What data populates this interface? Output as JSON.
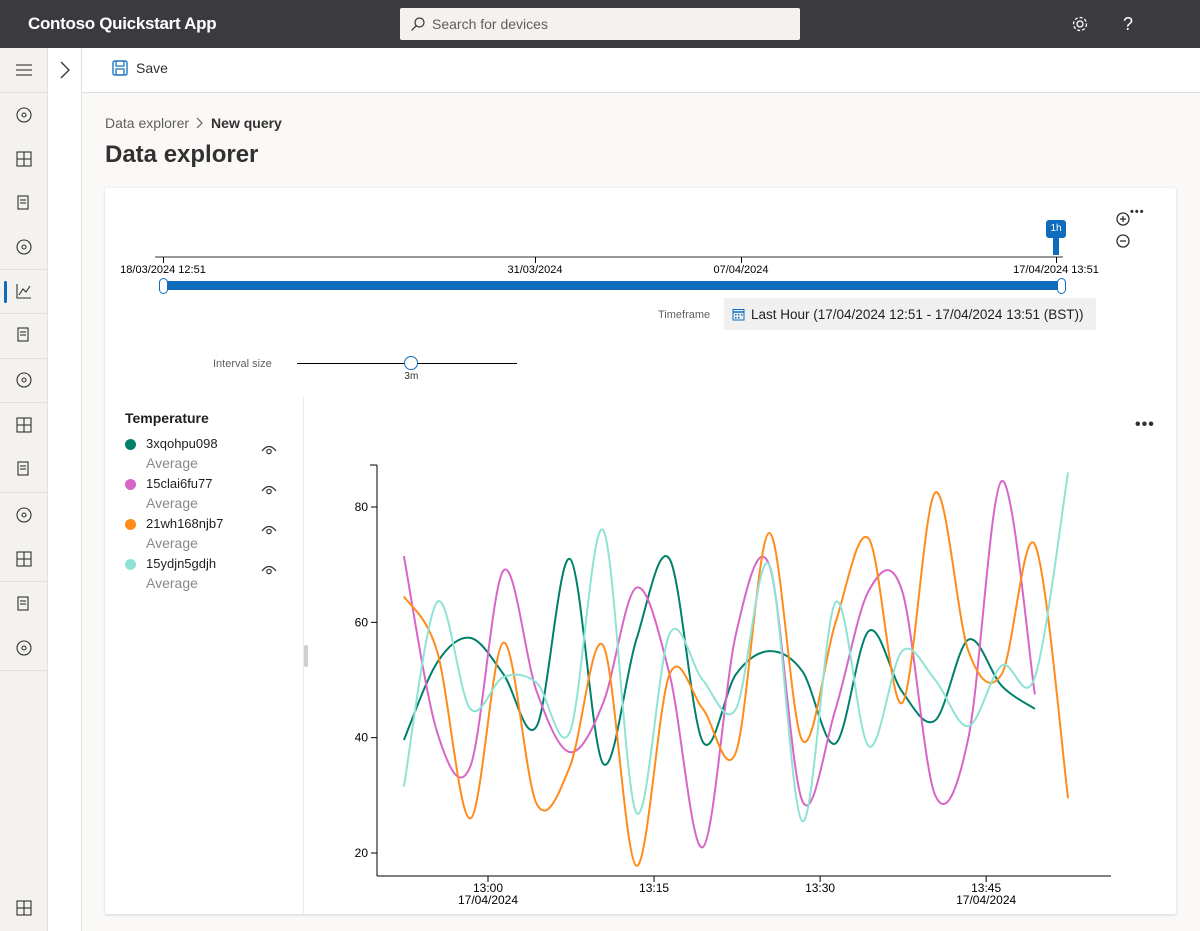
{
  "header": {
    "app_title": "Contoso Quickstart App",
    "search_placeholder": "Search for devices",
    "icons": [
      "settings-icon",
      "help-icon"
    ],
    "help_glyph": "?"
  },
  "sidebar": {
    "items": [
      "menu-icon",
      "dashboard-icon",
      "analytics-icon",
      "devices-icon",
      "device-groups-icon",
      "data-explorer-icon",
      "dashboards-icon",
      "device-templates-icon",
      "rules-icon",
      "data-export-icon",
      "audit-icon",
      "permissions-icon",
      "customization-icon",
      "app-settings-icon",
      "iot-central-home-icon"
    ],
    "active": "data-explorer-icon"
  },
  "toolbar": {
    "save_label": "Save"
  },
  "breadcrumb": {
    "parent": "Data explorer",
    "current": "New query"
  },
  "page_title": "Data explorer",
  "time_brush": {
    "tick_labels": [
      "18/03/2024 12:51",
      "31/03/2024",
      "07/04/2024",
      "17/04/2024 13:51"
    ],
    "handle_label": "1h",
    "selected_fraction_start": 0,
    "selected_fraction_end": 1
  },
  "timeframe": {
    "label": "Timeframe",
    "value": "Last Hour (17/04/2024 12:51 - 17/04/2024 13:51 (BST))"
  },
  "interval": {
    "label": "Interval size",
    "value": "3m",
    "slider_fraction": 0.52
  },
  "legend": {
    "title": "Temperature",
    "items": [
      {
        "name": "3xqohpu098",
        "aggregation": "Average",
        "color": "#00806b"
      },
      {
        "name": "15clai6fu77",
        "aggregation": "Average",
        "color": "#d865c8"
      },
      {
        "name": "21wh168njb7",
        "aggregation": "Average",
        "color": "#ff8c1a"
      },
      {
        "name": "15ydjn5gdjh",
        "aggregation": "Average",
        "color": "#8fe3d4"
      }
    ]
  },
  "more_glyph": "•••",
  "chart_data": {
    "type": "line",
    "x": [
      "12:52",
      "12:55",
      "12:58",
      "13:01",
      "13:04",
      "13:07",
      "13:10",
      "13:13",
      "13:16",
      "13:19",
      "13:22",
      "13:25",
      "13:28",
      "13:31",
      "13:34",
      "13:37",
      "13:40",
      "13:43",
      "13:46",
      "13:49",
      "13:52"
    ],
    "ylim": [
      17,
      87
    ],
    "yticks": [
      "20",
      "40",
      "60",
      "80"
    ],
    "xticks": [
      {
        "time": "13:00",
        "label": "13:00",
        "date": "17/04/2024"
      },
      {
        "time": "13:15",
        "label": "13:15",
        "date": ""
      },
      {
        "time": "13:30",
        "label": "13:30",
        "date": ""
      },
      {
        "time": "13:45",
        "label": "13:45",
        "date": "17/04/2024"
      }
    ],
    "series": [
      {
        "name": "3xqohpu098",
        "color": "#00806b",
        "values": [
          39.6,
          53,
          57.3,
          51,
          42,
          71,
          35.5,
          57,
          71,
          39.3,
          51,
          55,
          51.5,
          39,
          58.5,
          48,
          43,
          57,
          49,
          45,
          null
        ]
      },
      {
        "name": "15clai6fu77",
        "color": "#d865c8",
        "values": [
          71.5,
          41,
          35,
          69,
          48,
          37.5,
          46,
          66,
          51,
          21,
          58,
          70,
          29,
          45,
          65.5,
          65.5,
          30,
          40,
          84.5,
          47.5,
          null
        ]
      },
      {
        "name": "21wh168njb7",
        "color": "#ff8c1a",
        "values": [
          64.5,
          55,
          26,
          56.5,
          28.5,
          35,
          56,
          17.8,
          51,
          45,
          37.5,
          75.5,
          39.5,
          60,
          74.5,
          46,
          82.5,
          55,
          51,
          73.5,
          29.5
        ]
      },
      {
        "name": "15ydjn5gdjh",
        "color": "#8fe3d4",
        "values": [
          31.5,
          63.5,
          45,
          50.5,
          49.5,
          41,
          76,
          27,
          58,
          50,
          45,
          70,
          25.5,
          63.5,
          38.5,
          55,
          50,
          42,
          52.5,
          50.5,
          86
        ]
      }
    ]
  }
}
